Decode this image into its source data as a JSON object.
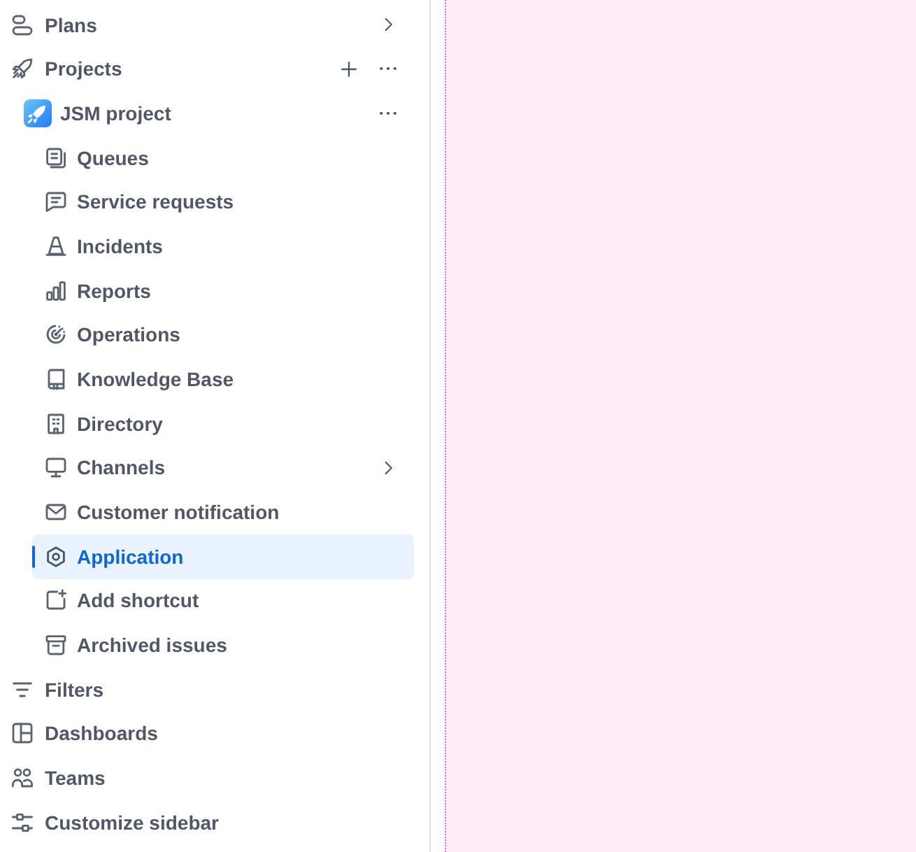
{
  "sidebar": {
    "items": [
      {
        "kind": "link",
        "label": "Plans",
        "selected": false,
        "expandable": true
      },
      {
        "kind": "section",
        "label": "Projects",
        "selected": false,
        "expandable": false,
        "children": [
          {
            "kind": "project",
            "label": "JSM project",
            "selected": false,
            "expandable": false,
            "children": [
              {
                "label": "Queues",
                "selected": false,
                "expandable": false
              },
              {
                "label": "Service requests",
                "selected": false,
                "expandable": false
              },
              {
                "label": "Incidents",
                "selected": false,
                "expandable": false
              },
              {
                "label": "Reports",
                "selected": false,
                "expandable": false
              },
              {
                "label": "Operations",
                "selected": false,
                "expandable": false
              },
              {
                "label": "Knowledge Base",
                "selected": false,
                "expandable": false
              },
              {
                "label": "Directory",
                "selected": false,
                "expandable": false
              },
              {
                "label": "Channels",
                "selected": false,
                "expandable": true
              },
              {
                "label": "Customer notification",
                "selected": false,
                "expandable": false
              },
              {
                "label": "Application",
                "selected": true,
                "expandable": false
              },
              {
                "label": "Add shortcut",
                "selected": false,
                "expandable": false
              },
              {
                "label": "Archived issues",
                "selected": false,
                "expandable": false
              }
            ]
          }
        ]
      },
      {
        "kind": "link",
        "label": "Filters",
        "selected": false,
        "expandable": false
      },
      {
        "kind": "link",
        "label": "Dashboards",
        "selected": false,
        "expandable": false
      },
      {
        "kind": "link",
        "label": "Teams",
        "selected": false,
        "expandable": false
      },
      {
        "kind": "link",
        "label": "Customize sidebar",
        "selected": false,
        "expandable": false
      }
    ]
  }
}
